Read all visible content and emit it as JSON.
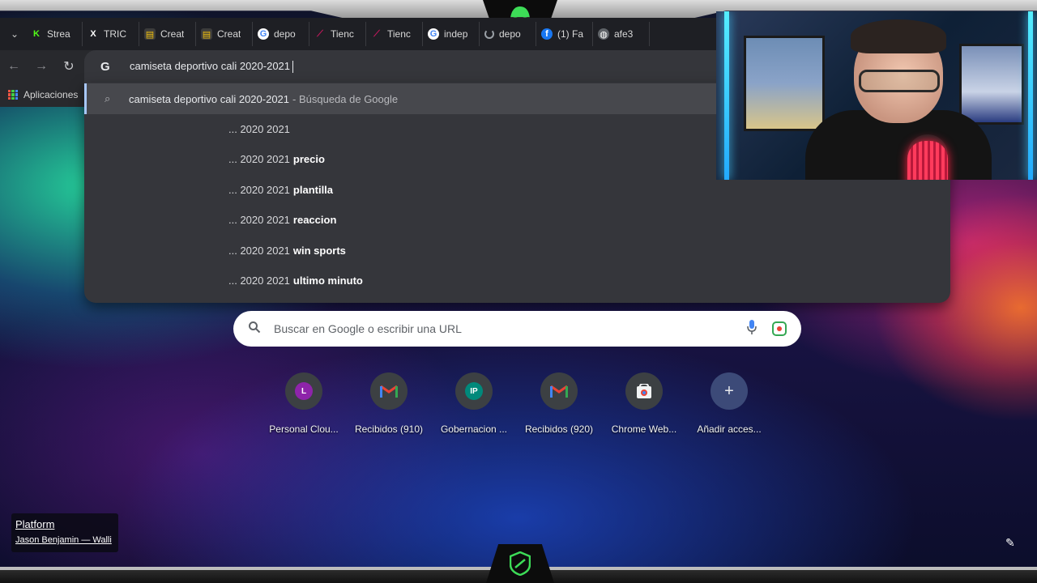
{
  "tabs": [
    {
      "label": "Strea",
      "icon": "kick-icon",
      "color": "#53fc18"
    },
    {
      "label": "TRIC",
      "icon": "x-icon",
      "color": "#ffffff"
    },
    {
      "label": "Creat",
      "icon": "doc-icon",
      "color": "#f4c20d"
    },
    {
      "label": "Creat",
      "icon": "doc-icon",
      "color": "#f4c20d"
    },
    {
      "label": "depo",
      "icon": "google-icon",
      "color": "#4285f4"
    },
    {
      "label": "Tienc",
      "icon": "store-icon",
      "color": "#c2185b"
    },
    {
      "label": "Tienc",
      "icon": "store-icon",
      "color": "#c2185b"
    },
    {
      "label": "indep",
      "icon": "google-icon",
      "color": "#4285f4"
    },
    {
      "label": "depo",
      "icon": "loading-icon",
      "color": "#9aa0a6"
    },
    {
      "label": "(1) Fa",
      "icon": "facebook-icon",
      "color": "#1877f2"
    },
    {
      "label": "afe3",
      "icon": "globe-icon",
      "color": "#9aa0a6"
    }
  ],
  "omnibox": {
    "text": "camiseta deportivo cali 2020-2021",
    "icon": "google-g-icon"
  },
  "bookmarks": {
    "apps_label": "Aplicaciones"
  },
  "suggestions": {
    "main": {
      "query": "camiseta deportivo cali 2020-2021",
      "source": "- Búsqueda de Google"
    },
    "tails": [
      {
        "prefix": "... 2020 2021",
        "bold": ""
      },
      {
        "prefix": "... 2020 2021",
        "bold": "precio"
      },
      {
        "prefix": "... 2020 2021",
        "bold": "plantilla"
      },
      {
        "prefix": "... 2020 2021",
        "bold": "reaccion"
      },
      {
        "prefix": "... 2020 2021",
        "bold": "win sports"
      },
      {
        "prefix": "... 2020 2021",
        "bold": "ultimo minuto"
      }
    ]
  },
  "ntp": {
    "search_placeholder": "Buscar en Google o escribir una URL",
    "shortcuts": [
      {
        "label": "Personal Clou...",
        "initial": "L",
        "color": "#8e24aa"
      },
      {
        "label": "Recibidos (910)",
        "initial": "M",
        "color": "gmail"
      },
      {
        "label": "Gobernacion ...",
        "initial": "IP",
        "color": "#00897b"
      },
      {
        "label": "Recibidos (920)",
        "initial": "M",
        "color": "gmail"
      },
      {
        "label": "Chrome Web...",
        "initial": "",
        "color": "webstore"
      },
      {
        "label": "Añadir acces...",
        "initial": "+",
        "color": "add"
      }
    ]
  },
  "now_playing": {
    "title": "Platform",
    "artist": "Jason Benjamin — Walli"
  }
}
